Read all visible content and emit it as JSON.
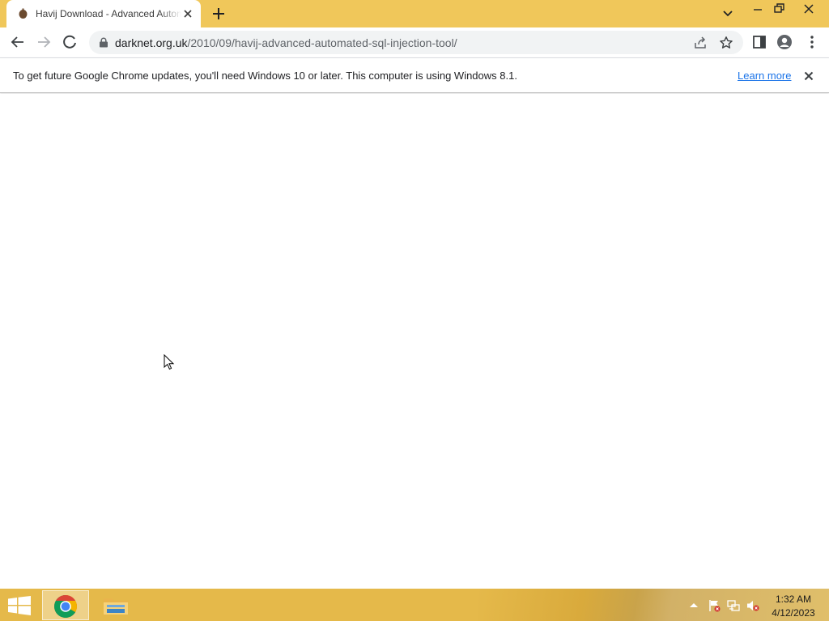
{
  "browser": {
    "tab": {
      "title": "Havij Download - Advanced Automated SQL Injection Tool",
      "favicon": "darknet-favicon-icon"
    },
    "toolbar": {
      "url_host": "darknet.org.uk",
      "url_path": "/2010/09/havij-advanced-automated-sql-injection-tool/",
      "loading": true
    },
    "infobar": {
      "message": "To get future Google Chrome updates, you'll need Windows 10 or later. This computer is using Windows 8.1.",
      "link": "Learn more"
    },
    "colors": {
      "frame": "#f0c75a",
      "omnibox": "#f1f3f4",
      "link": "#1a73e8"
    }
  },
  "taskbar": {
    "pinned": [
      "windows-start-icon",
      "chrome-icon",
      "file-explorer-icon"
    ],
    "tray_icons": [
      "show-hidden-icons",
      "action-center-flag-icon",
      "network-icon",
      "volume-muted-icon"
    ],
    "clock": {
      "time": "1:32 AM",
      "date": "4/12/2023"
    },
    "color": "#e5b94a"
  }
}
